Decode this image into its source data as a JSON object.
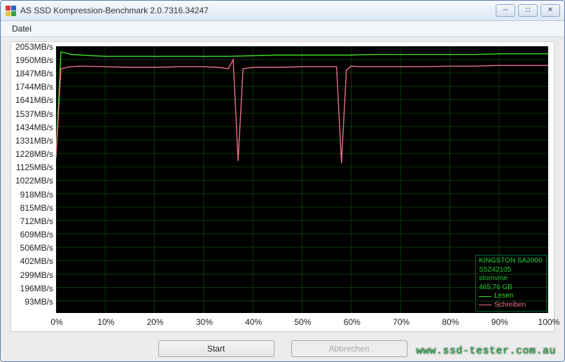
{
  "window": {
    "title": "AS SSD Kompression-Benchmark 2.0.7316.34247"
  },
  "menu": {
    "file": "Datei"
  },
  "buttons": {
    "start": "Start",
    "abort": "Abbrechen"
  },
  "legend": {
    "device": "KINGSTON SA2000",
    "firmware": "S5Z42105",
    "driver": "stornvme",
    "capacity": "465,76 GB",
    "read_label": "Lesen",
    "write_label": "Schreiben"
  },
  "watermark": "www.ssd-tester.com.au",
  "chart_data": {
    "type": "line",
    "xlabel": "",
    "ylabel": "",
    "xlim": [
      0,
      100
    ],
    "ylim": [
      0,
      2053
    ],
    "x_ticks": [
      "0%",
      "10%",
      "20%",
      "30%",
      "40%",
      "50%",
      "60%",
      "70%",
      "80%",
      "90%",
      "100%"
    ],
    "y_ticks": [
      "93MB/s",
      "196MB/s",
      "299MB/s",
      "402MB/s",
      "506MB/s",
      "609MB/s",
      "712MB/s",
      "815MB/s",
      "918MB/s",
      "1022MB/s",
      "1125MB/s",
      "1228MB/s",
      "1331MB/s",
      "1434MB/s",
      "1537MB/s",
      "1641MB/s",
      "1744MB/s",
      "1847MB/s",
      "1950MB/s",
      "2053MB/s"
    ],
    "series": [
      {
        "name": "Lesen",
        "color": "#37E01E",
        "x": [
          0,
          1,
          3,
          5,
          10,
          15,
          20,
          25,
          30,
          35,
          40,
          45,
          50,
          55,
          60,
          65,
          70,
          75,
          80,
          85,
          90,
          95,
          100
        ],
        "y": [
          1210,
          2010,
          1990,
          1985,
          1975,
          1975,
          1975,
          1975,
          1975,
          1975,
          1980,
          1985,
          1985,
          1985,
          1985,
          1990,
          1990,
          1990,
          1990,
          1990,
          1995,
          1995,
          1995
        ]
      },
      {
        "name": "Schreiben",
        "color": "#E86F86",
        "x": [
          0,
          1,
          3,
          5,
          10,
          15,
          20,
          25,
          30,
          33,
          35,
          36,
          37,
          38,
          40,
          45,
          50,
          55,
          57,
          58,
          59,
          60,
          62,
          65,
          70,
          75,
          80,
          85,
          90,
          95,
          100
        ],
        "y": [
          1195,
          1880,
          1895,
          1900,
          1895,
          1890,
          1890,
          1895,
          1895,
          1890,
          1880,
          1950,
          1170,
          1880,
          1890,
          1890,
          1895,
          1895,
          1895,
          1155,
          1870,
          1900,
          1895,
          1895,
          1895,
          1895,
          1900,
          1900,
          1905,
          1905,
          1905
        ]
      }
    ]
  }
}
